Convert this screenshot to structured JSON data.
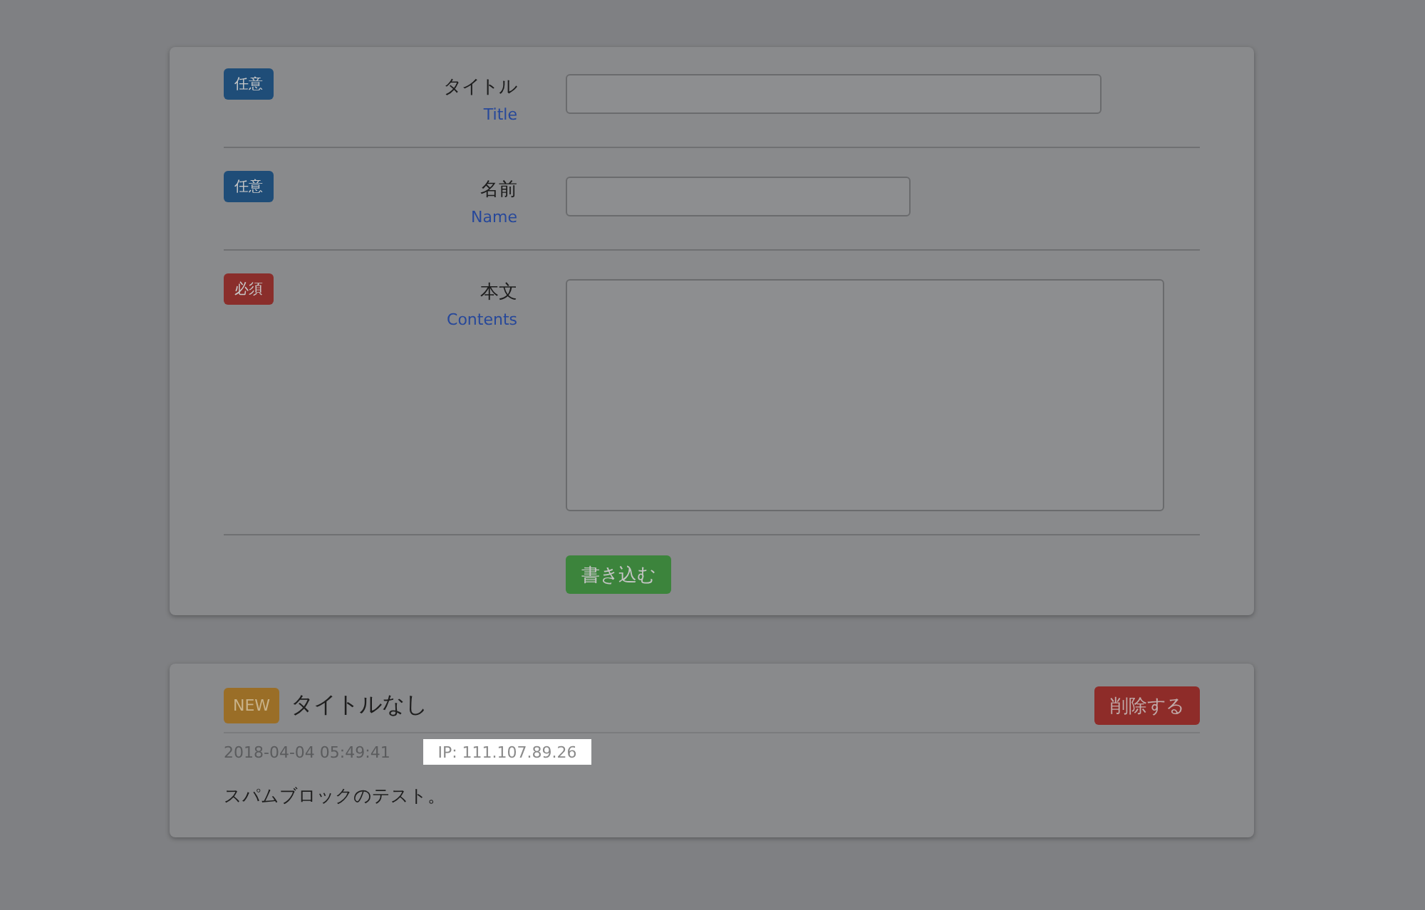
{
  "form": {
    "fields": [
      {
        "badge": "任意",
        "required": false,
        "label": "タイトル",
        "sublabel": "Title",
        "kind": "wide"
      },
      {
        "badge": "任意",
        "required": false,
        "label": "名前",
        "sublabel": "Name",
        "kind": "narrow"
      },
      {
        "badge": "必須",
        "required": true,
        "label": "本文",
        "sublabel": "Contents",
        "kind": "textarea"
      }
    ],
    "submit": "書き込む"
  },
  "post": {
    "badge": "NEW",
    "title": "タイトルなし",
    "delete": "削除する",
    "date": "2018-04-04 05:49:41",
    "ip": "IP: 111.107.89.26",
    "body": "スパムブロックのテスト。"
  }
}
